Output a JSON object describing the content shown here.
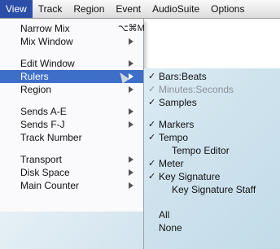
{
  "menubar": {
    "items": [
      "View",
      "Track",
      "Region",
      "Event",
      "AudioSuite",
      "Options"
    ]
  },
  "view_menu": {
    "items": [
      {
        "label": "Narrow Mix",
        "shortcut": "⌥⌘M",
        "arrow": false
      },
      {
        "label": "Mix Window",
        "shortcut": "",
        "arrow": true
      },
      {
        "label": "Edit Window",
        "shortcut": "",
        "arrow": true
      },
      {
        "label": "Rulers",
        "shortcut": "",
        "arrow": true
      },
      {
        "label": "Region",
        "shortcut": "",
        "arrow": true
      },
      {
        "label": "Sends A-E",
        "shortcut": "",
        "arrow": true
      },
      {
        "label": "Sends F-J",
        "shortcut": "",
        "arrow": true
      },
      {
        "label": "Track Number",
        "shortcut": "",
        "arrow": false
      },
      {
        "label": "Transport",
        "shortcut": "",
        "arrow": true
      },
      {
        "label": "Disk Space",
        "shortcut": "",
        "arrow": true
      },
      {
        "label": "Main Counter",
        "shortcut": "",
        "arrow": true
      }
    ],
    "highlighted": "Rulers"
  },
  "rulers_submenu": {
    "check_glyph": "✓",
    "items": [
      {
        "label": "Bars:Beats",
        "checked": true,
        "disabled": false,
        "indent": false
      },
      {
        "label": "Minutes:Seconds",
        "checked": true,
        "disabled": true,
        "indent": false
      },
      {
        "label": "Samples",
        "checked": true,
        "disabled": false,
        "indent": false
      },
      {
        "label": "Markers",
        "checked": true,
        "disabled": false,
        "indent": false
      },
      {
        "label": "Tempo",
        "checked": true,
        "disabled": false,
        "indent": false
      },
      {
        "label": "Tempo Editor",
        "checked": false,
        "disabled": false,
        "indent": true
      },
      {
        "label": "Meter",
        "checked": true,
        "disabled": false,
        "indent": false
      },
      {
        "label": "Key Signature",
        "checked": true,
        "disabled": false,
        "indent": false
      },
      {
        "label": "Key Signature Staff",
        "checked": false,
        "disabled": false,
        "indent": true
      },
      {
        "label": "All",
        "checked": false,
        "disabled": false,
        "indent": false
      },
      {
        "label": "None",
        "checked": false,
        "disabled": false,
        "indent": false
      }
    ]
  },
  "colors": {
    "highlight": "#3d6fc9",
    "menubar_active": "#2b4fa8"
  }
}
